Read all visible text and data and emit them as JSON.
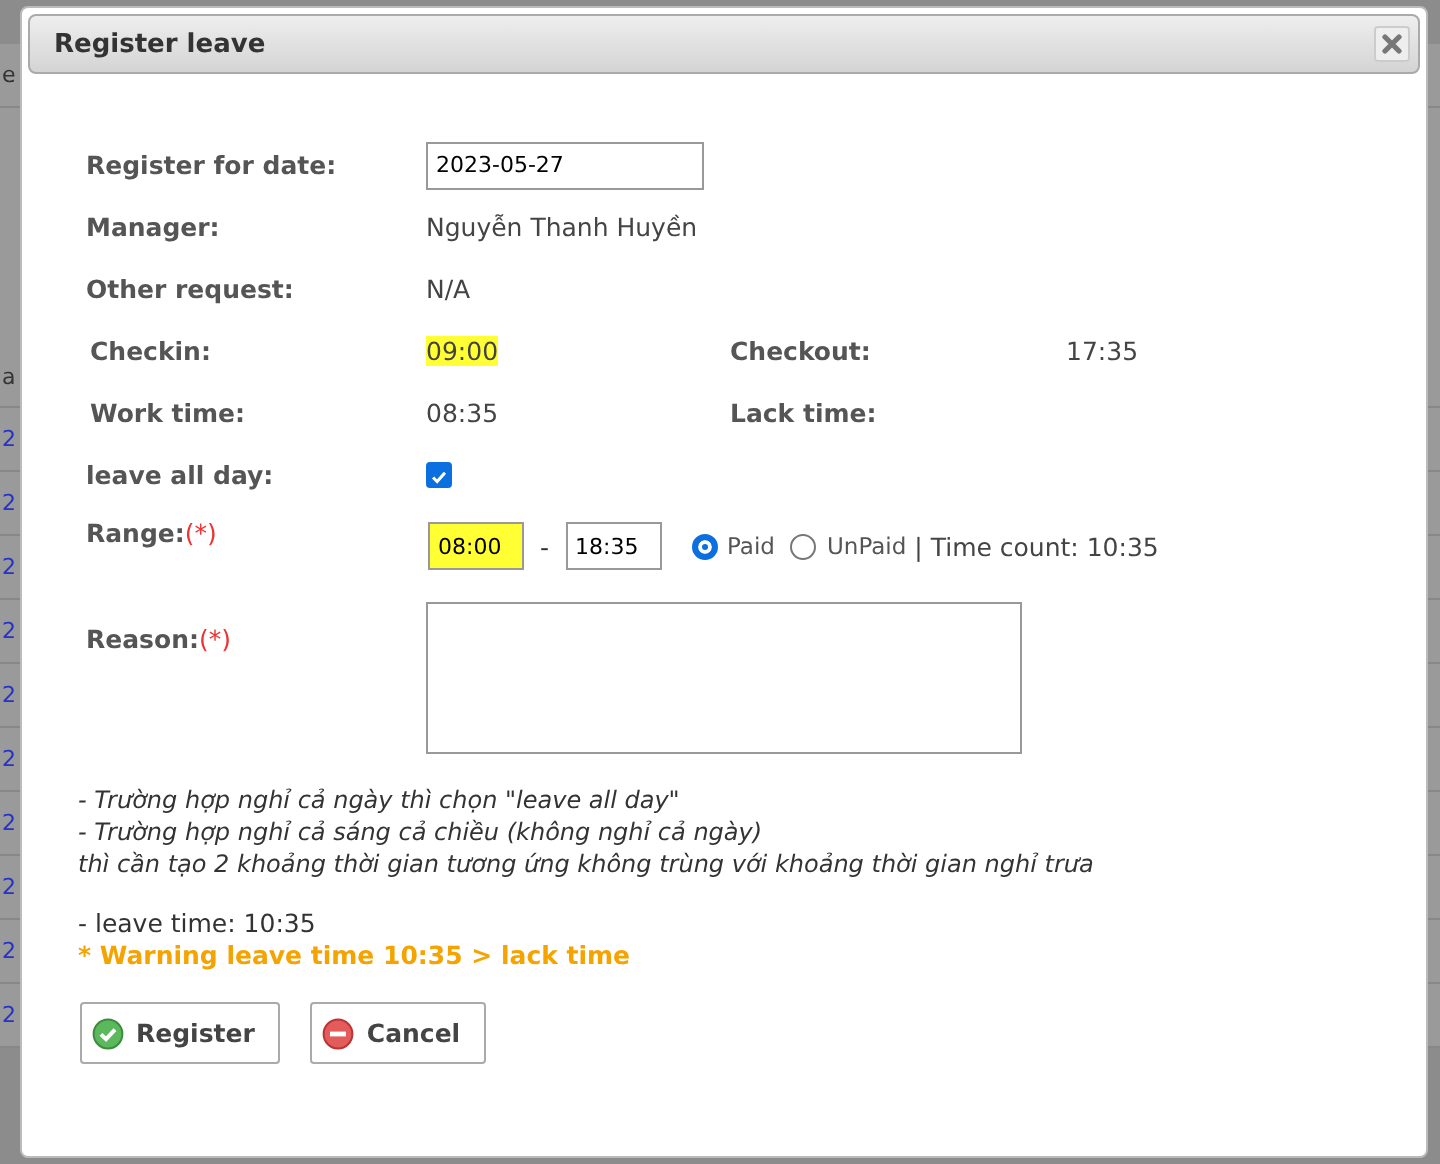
{
  "background": {
    "fragments": [
      {
        "text": "e",
        "kind": "plain"
      },
      {
        "text": "a",
        "kind": "plain"
      },
      {
        "text": "2",
        "kind": "link"
      },
      {
        "text": "2",
        "kind": "link"
      },
      {
        "text": "2",
        "kind": "link"
      },
      {
        "text": "2",
        "kind": "link"
      },
      {
        "text": "2",
        "kind": "link"
      },
      {
        "text": "2",
        "kind": "link"
      },
      {
        "text": "2",
        "kind": "link"
      },
      {
        "text": "2",
        "kind": "link"
      },
      {
        "text": "2",
        "kind": "link"
      },
      {
        "text": "2",
        "kind": "link"
      }
    ]
  },
  "dialog": {
    "title": "Register leave",
    "register_date": {
      "label": "Register for date:",
      "value": "2023-05-27"
    },
    "manager": {
      "label": "Manager:",
      "value": "Nguyễn Thanh Huyền"
    },
    "other_request": {
      "label": "Other request:",
      "value": "N/A"
    },
    "checkin": {
      "label": "Checkin:",
      "value": "09:00",
      "highlighted": true
    },
    "checkout": {
      "label": "Checkout:",
      "value": "17:35",
      "highlighted": false
    },
    "work_time": {
      "label": "Work time:",
      "value": "08:35"
    },
    "lack_time": {
      "label": "Lack time:"
    },
    "leave_all_day": {
      "label": "leave all day:",
      "checked": true
    },
    "range": {
      "label": "Range:",
      "required": "(*)",
      "from": "08:00",
      "from_highlighted": true,
      "separator": "-",
      "to": "18:35",
      "options": [
        {
          "label": "Paid",
          "selected": true
        },
        {
          "label": "UnPaid",
          "selected": false
        }
      ],
      "time_count": "| Time count: 10:35"
    },
    "reason": {
      "label": "Reason:",
      "required": "(*)"
    },
    "notes": [
      "- Trường hợp nghỉ cả ngày thì chọn \"leave all day\"",
      "- Trường hợp nghỉ cả sáng cả chiều (không nghỉ cả ngày)",
      "thì cần tạo 2 khoảng thời gian tương ứng không trùng với khoảng thời gian nghỉ trưa"
    ],
    "leave_time": "- leave time: 10:35",
    "warning": "* Warning leave time 10:35 > lack time",
    "buttons": [
      {
        "label": "Register",
        "kind": "ok"
      },
      {
        "label": "Cancel",
        "kind": "cancel"
      }
    ]
  }
}
